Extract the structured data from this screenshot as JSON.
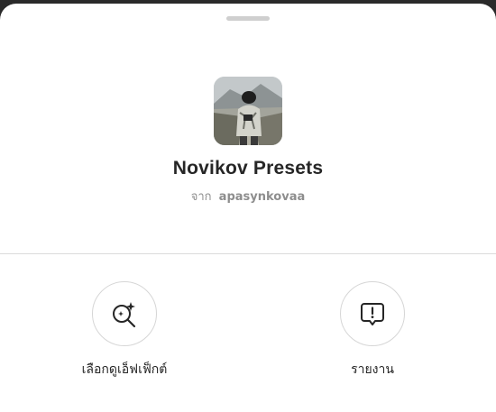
{
  "effect": {
    "name": "Novikov Presets",
    "by_prefix": "จาก",
    "author": "apasynkovaa",
    "thumbnail_icon": "effect-preview-photo"
  },
  "actions": [
    {
      "label": "เลือกดูเอ็ฟเฟ็กต์",
      "icon": "sparkle-search-icon"
    },
    {
      "label": "รายงาน",
      "icon": "report-icon"
    }
  ],
  "colors": {
    "sheet_background": "#ffffff",
    "text_primary": "#262626",
    "text_secondary": "#8e8e8e",
    "divider": "#dbdbdb"
  }
}
